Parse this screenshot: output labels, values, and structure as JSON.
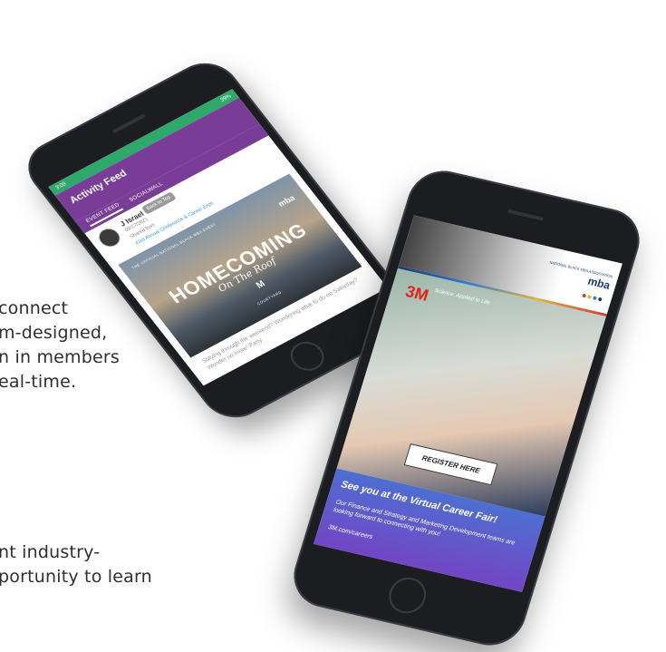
{
  "background": {
    "paragraph_1": [
      "connect",
      "m-designed,",
      "n in members",
      "eal-time."
    ],
    "paragraph_2": [
      "nt industry-",
      "portunity to learn"
    ]
  },
  "phone_feed": {
    "status_left": "3:09",
    "status_right": "39%",
    "title": "Activity Feed",
    "tabs": [
      {
        "label": "EVENT FEED",
        "active": true
      },
      {
        "label": "SOCIALWALL",
        "active": false
      }
    ],
    "back_to_top": "Back to Top",
    "post": {
      "author": "J Israel",
      "date": "09/17/2021",
      "shared_prefix": "Shared from",
      "shared_link": "43rd Annual Conference & Career Expo",
      "banner_kicker": "THE OFFICIAL NATIONAL BLACK MBA EVENT",
      "banner_logo": "mba",
      "banner_title": "HOMECOMING",
      "banner_subtitle": "On The Roof",
      "banner_mark": "M",
      "banner_venue": "COURTYARD",
      "text": "Staying through the weekend? Wondering what to do on Saturday? Wonder no more! Party"
    }
  },
  "phone_ad": {
    "org_logo": "mba",
    "org_small": "NATIONAL BLACK MBA ASSOCIATION",
    "dot_colors": [
      "#d23a3a",
      "#e2b43c",
      "#2f7bd1",
      "#1e3a6e"
    ],
    "brand": "3M",
    "tagline": "Science. Applied to Life.",
    "register_label": "REGISTER HERE",
    "headline": "See you at the Virtual Career Fair!",
    "body": "Our Finance and Strategy and Marketing Development teams are looking forward to connecting with you!",
    "url": "3M.com/careers"
  }
}
